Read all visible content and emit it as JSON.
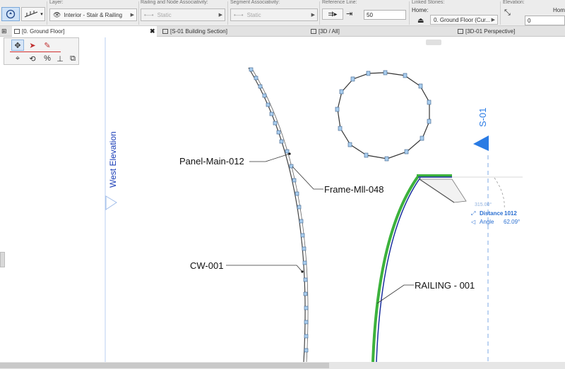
{
  "toolbar": {
    "layer_label": "Layer:",
    "layer_value": "Interior - Stair & Railing",
    "railing_assoc_label": "Railing and Node Associativity:",
    "railing_assoc_value": "Static",
    "segment_assoc_label": "Segment Associativity:",
    "segment_assoc_value": "Static",
    "reference_line_label": "Reference Line:",
    "reference_offset_value": "50",
    "linked_stories_label": "Linked Stories:",
    "home_label": "Home:",
    "home_story_value": "0. Ground Floor (Cur...",
    "elevation_label": "Elevation:",
    "home_right_label": "Home",
    "elevation_value": "0"
  },
  "tabs": [
    {
      "label": "[0. Ground Floor]"
    },
    {
      "label": "[S-01 Building Section]"
    },
    {
      "label": "[3D / All]"
    },
    {
      "label": "[3D-01 Perspective]"
    }
  ],
  "palette": {
    "tools": [
      {
        "icon": "move-icon",
        "glyph": "✥"
      },
      {
        "icon": "arrow-pointer-icon",
        "glyph": "➤"
      },
      {
        "icon": "pencil-icon",
        "glyph": "✎"
      },
      {
        "icon": "node-move-icon",
        "glyph": "⌖"
      },
      {
        "icon": "rotate-icon",
        "glyph": "⟲"
      },
      {
        "icon": "percent-icon",
        "glyph": "%"
      },
      {
        "icon": "elevation-icon",
        "glyph": "⊥"
      },
      {
        "icon": "copy-icon",
        "glyph": "⧉"
      }
    ]
  },
  "drawing": {
    "west_elevation_label": "West Elevation",
    "section_marker_label": "S-01",
    "label_panel": "Panel-Main-012",
    "label_frame": "Frame-Mll-048",
    "label_curtain_wall": "CW-001",
    "label_railing": "RAILING - 001",
    "tracker_angle_hint": "315.00°",
    "tracker_distance_label": "Distance",
    "tracker_distance_value": "1012",
    "tracker_angle_label": "Angle",
    "tracker_angle_value": "62.09°"
  },
  "colors": {
    "accent_blue": "#1f6fd8",
    "railing_green": "#3cb23c",
    "railing_blue": "#1b2f9e",
    "panel_blue": "#9cc4e8",
    "tracker_blue": "#2a6fd1"
  }
}
